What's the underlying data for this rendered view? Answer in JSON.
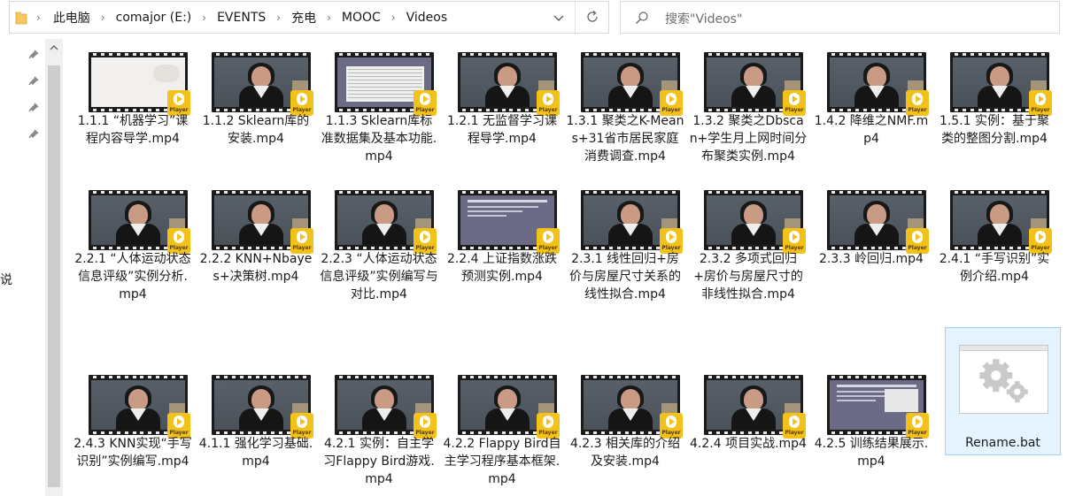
{
  "address_bar": {
    "breadcrumbs": [
      "此电脑",
      "comajor (E:)",
      "EVENTS",
      "充电",
      "MOOC",
      "Videos"
    ],
    "folder_icon": "folder-icon",
    "dropdown_icon": "chevron-down-icon",
    "refresh_icon": "refresh-icon"
  },
  "search": {
    "placeholder": "搜索\"Videos\"",
    "icon": "search-icon"
  },
  "nav_pane": {
    "pinned_icons": 4,
    "side_text": "说"
  },
  "colors": {
    "player_badge": "#f2c21b",
    "selection_bg": "#e5f3ff",
    "selection_border": "#99d1ff"
  },
  "files": [
    {
      "name": "1.1.1 “机器学习”课程内容导学.mp4",
      "thumb": "white"
    },
    {
      "name": "1.1.2 Sklearn库的安装.mp4",
      "thumb": "person"
    },
    {
      "name": "1.1.3 Sklearn库标准数据集及基本功能.mp4",
      "thumb": "table"
    },
    {
      "name": "1.2.1 无监督学习课程导学.mp4",
      "thumb": "person"
    },
    {
      "name": "1.3.1 聚类之K-Means+31省市居民家庭消费调查.mp4",
      "thumb": "person"
    },
    {
      "name": "1.3.2 聚类之Dbscan+学生月上网时间分布聚类实例.mp4",
      "thumb": "person"
    },
    {
      "name": "1.4.2 降维之NMF.mp4",
      "thumb": "person"
    },
    {
      "name": "1.5.1 实例：基于聚类的整图分割.mp4",
      "thumb": "person"
    },
    {
      "name": "2.2.1 “人体运动状态信息评级”实例分析.mp4",
      "thumb": "person"
    },
    {
      "name": "2.2.2 KNN+Nbayes+决策树.mp4",
      "thumb": "person"
    },
    {
      "name": "2.2.3 “人体运动状态信息评级”实例编写与对比.mp4",
      "thumb": "person"
    },
    {
      "name": "2.2.4 上证指数涨跌预测实例.mp4",
      "thumb": "slide"
    },
    {
      "name": "2.3.1 线性回归+房价与房屋尺寸关系的线性拟合.mp4",
      "thumb": "person"
    },
    {
      "name": "2.3.2 多项式回归+房价与房屋尺寸的非线性拟合.mp4",
      "thumb": "person"
    },
    {
      "name": "2.3.3 岭回归.mp4",
      "thumb": "person"
    },
    {
      "name": "2.4.1 “手写识别”实例介绍.mp4",
      "thumb": "person"
    },
    {
      "name": "2.4.3 KNN实现“手写识别”实例编写.mp4",
      "thumb": "person"
    },
    {
      "name": "4.1.1 强化学习基础.mp4",
      "thumb": "person"
    },
    {
      "name": "4.2.1 实例：自主学习Flappy Bird游戏.mp4",
      "thumb": "person"
    },
    {
      "name": "4.2.2 Flappy Bird自主学习程序基本框架.mp4",
      "thumb": "person"
    },
    {
      "name": "4.2.3 相关库的介绍及安装.mp4",
      "thumb": "person"
    },
    {
      "name": "4.2.4 项目实战.mp4",
      "thumb": "person"
    },
    {
      "name": "4.2.5 训练结果展示.mp4",
      "thumb": "slide2"
    }
  ],
  "player_badge_label": "Player",
  "bat_file": {
    "name": "Rename.bat",
    "icon": "settings-gears-icon",
    "selected": true
  }
}
